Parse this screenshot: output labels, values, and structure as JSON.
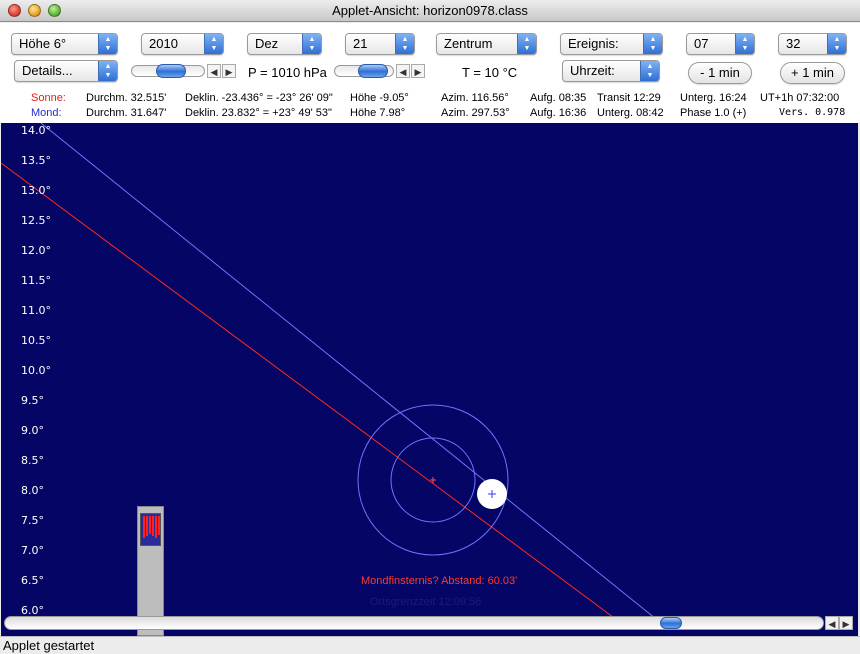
{
  "window": {
    "title": "Applet-Ansicht: horizon0978.class"
  },
  "controls": {
    "hoehe": "Höhe 6°",
    "year": "2010",
    "month": "Dez",
    "day": "21",
    "center": "Zentrum",
    "event": "Ereignis:",
    "hour": "07",
    "minute": "32",
    "details": "Details...",
    "pressure": "P = 1010 hPa",
    "temperature": "T = 10 °C",
    "time_mode": "Uhrzeit:",
    "minus_min": "- 1 min",
    "plus_min": "+ 1 min"
  },
  "sun": {
    "label": "Sonne:",
    "diameter": "Durchm. 32.515'",
    "declination": "Deklin. -23.436° = -23° 26' 09\"",
    "altitude": "Höhe -9.05°",
    "azimuth": "Azim. 116.56°",
    "rise": "Aufg. 08:35",
    "transit": "Transit 12:29",
    "set": "Unterg. 16:24",
    "ut": "UT+1h  07:32:00"
  },
  "moon": {
    "label": "Mond:",
    "diameter": "Durchm. 31.647'",
    "declination": "Deklin. 23.832° = +23° 49' 53\"",
    "altitude": "Höhe 7.98°",
    "azimuth": "Azim. 297.53°",
    "rise": "Aufg. 16:36",
    "set": "Unterg. 08:42",
    "phase": "Phase 1.0 (+)",
    "version": "Vers. 0.978"
  },
  "sky": {
    "y_ticks": [
      "14.0°",
      "13.5°",
      "13.0°",
      "12.5°",
      "12.0°",
      "11.5°",
      "11.0°",
      "10.5°",
      "10.0°",
      "9.5°",
      "9.0°",
      "8.5°",
      "8.0°",
      "7.5°",
      "7.0°",
      "6.5°",
      "6.0°"
    ],
    "eclipse_text": "Mondfinsternis? Abstand: 60.03'",
    "local_time_text": "Ortsgrenzzeit 12:09:56",
    "colors": {
      "background": "#050565",
      "moon_path": "#6f74ff",
      "ecliptic": "#ff2a1a",
      "eclipse_text": "#ff3a2a",
      "moon": "#ffffff"
    }
  },
  "status": {
    "text": "Applet gestartet"
  }
}
